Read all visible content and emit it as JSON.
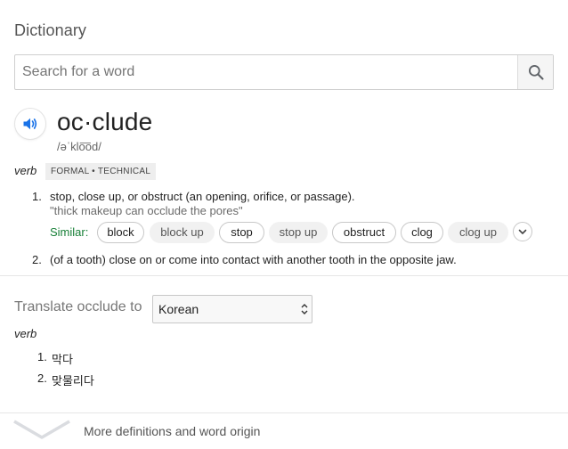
{
  "title": "Dictionary",
  "search": {
    "placeholder": "Search for a word",
    "value": ""
  },
  "entry": {
    "word": "oc·clude",
    "phonetic": "/əˈklo͞od/",
    "part_of_speech": "verb",
    "register_tag": "FORMAL • TECHNICAL",
    "definitions": [
      {
        "number": "1.",
        "text": "stop, close up, or obstruct (an opening, orifice, or passage).",
        "example": "\"thick makeup can occlude the pores\""
      },
      {
        "number": "2.",
        "text": "(of a tooth) close on or come into contact with another tooth in the opposite jaw."
      }
    ],
    "similar_label": "Similar:",
    "similar": [
      "block",
      "block up",
      "stop",
      "stop up",
      "obstruct",
      "clog",
      "clog up"
    ]
  },
  "translate": {
    "label": "Translate occlude to",
    "selected_language": "Korean",
    "part_of_speech": "verb",
    "items": [
      {
        "number": "1.",
        "text": "막다"
      },
      {
        "number": "2.",
        "text": "맞물리다"
      }
    ]
  },
  "more_link": "More definitions and word origin",
  "colors": {
    "accent": "#1a73e8",
    "similar_green": "#188038",
    "chip_fill": "#f1f1f1"
  }
}
